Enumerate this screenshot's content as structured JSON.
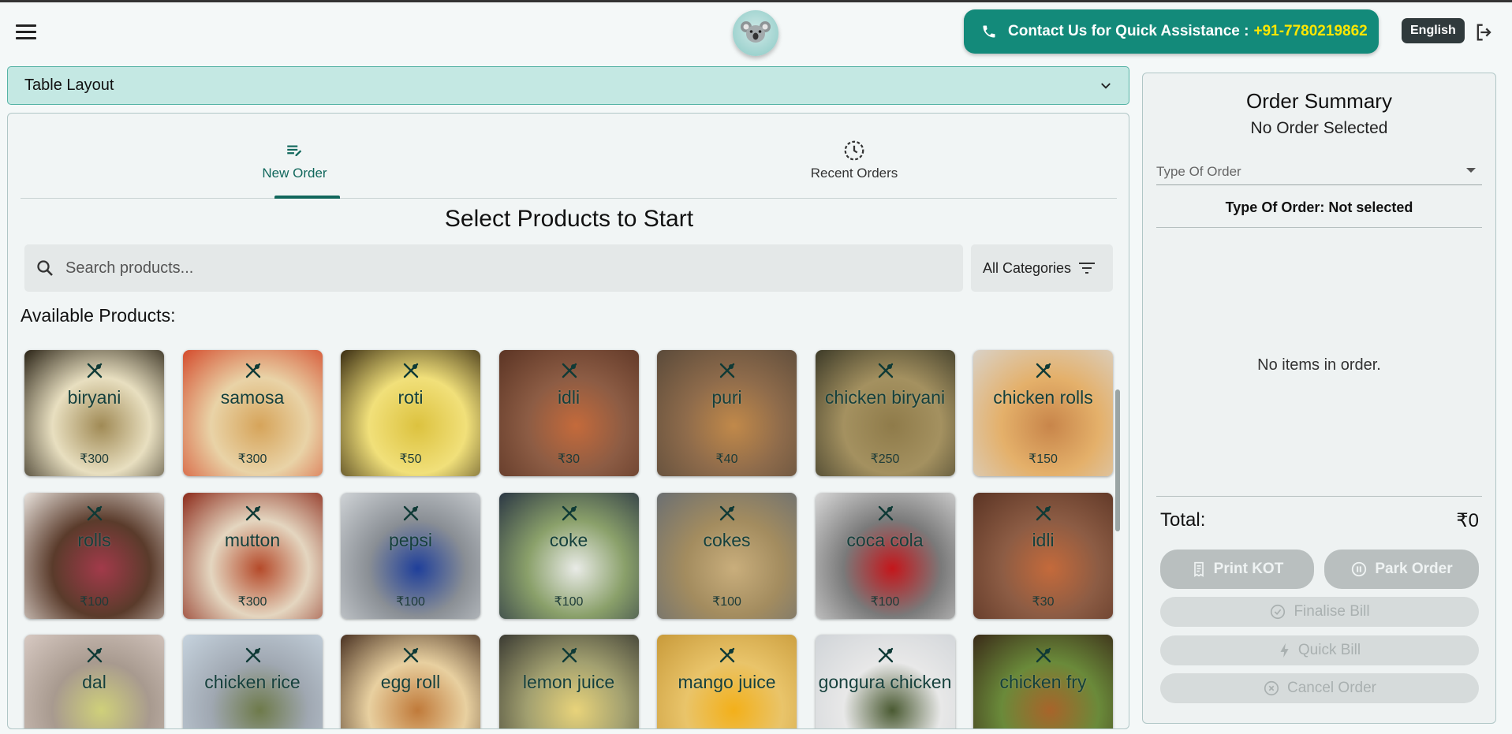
{
  "header": {
    "contact_label": "Contact Us for Quick Assistance :",
    "contact_phone": "+91-7780219862",
    "language": "English"
  },
  "table_layout": {
    "label": "Table Layout"
  },
  "tabs": [
    {
      "label": "New Order",
      "active": true
    },
    {
      "label": "Recent Orders",
      "active": false
    }
  ],
  "main": {
    "title": "Select Products to Start",
    "search_placeholder": "Search products...",
    "category_filter": "All Categories",
    "available_label": "Available Products:"
  },
  "products": [
    {
      "name": "biryani",
      "price": "₹300",
      "colors": [
        "#2a2316",
        "#a08a55",
        "#e8dfc0"
      ]
    },
    {
      "name": "samosa",
      "price": "₹300",
      "colors": [
        "#d44b2c",
        "#d6a45a",
        "#e9d3a7"
      ]
    },
    {
      "name": "roti",
      "price": "₹50",
      "colors": [
        "#3a2d12",
        "#dcc23f",
        "#f1e07a"
      ]
    },
    {
      "name": "idli",
      "price": "₹30",
      "colors": [
        "#5b3424",
        "#c46a3b",
        "#8c5c44"
      ]
    },
    {
      "name": "puri",
      "price": "₹40",
      "colors": [
        "#5a4a3a",
        "#c1894a",
        "#8e6b4b"
      ]
    },
    {
      "name": "chicken biryani",
      "price": "₹250",
      "colors": [
        "#3c3a28",
        "#8f7b4a",
        "#a49160"
      ]
    },
    {
      "name": "chicken rolls",
      "price": "₹150",
      "colors": [
        "#d9d2c8",
        "#c8854a",
        "#e4b06a"
      ]
    },
    {
      "name": "rolls",
      "price": "₹100",
      "colors": [
        "#e8e2dc",
        "#a23a4a",
        "#5a3b2b"
      ]
    },
    {
      "name": "mutton",
      "price": "₹300",
      "colors": [
        "#8c2a1a",
        "#b54a2a",
        "#e4d6c0"
      ]
    },
    {
      "name": "pepsi",
      "price": "₹100",
      "colors": [
        "#cfd3d6",
        "#1f3f9a",
        "#8a8f95"
      ]
    },
    {
      "name": "coke",
      "price": "₹100",
      "colors": [
        "#2b3744",
        "#e9ebe7",
        "#8aa06a"
      ]
    },
    {
      "name": "cokes",
      "price": "₹100",
      "colors": [
        "#6b6f72",
        "#c9ae7c",
        "#a38c5f"
      ]
    },
    {
      "name": "coca cola",
      "price": "₹100",
      "colors": [
        "#d8d8d8",
        "#c4161b",
        "#7a7a7a"
      ]
    },
    {
      "name": "idli",
      "price": "₹30",
      "colors": [
        "#5b3424",
        "#c46a3b",
        "#8c5c44"
      ]
    },
    {
      "name": "dal",
      "price": "",
      "colors": [
        "#d7c9c2",
        "#cfd07a",
        "#a89a8f"
      ]
    },
    {
      "name": "chicken rice",
      "price": "",
      "colors": [
        "#c6d3de",
        "#6e7a4a",
        "#a0a8b2"
      ]
    },
    {
      "name": "egg roll",
      "price": "",
      "colors": [
        "#4a3222",
        "#c07a3a",
        "#e8d0a0"
      ]
    },
    {
      "name": "lemon juice",
      "price": "",
      "colors": [
        "#3a3a32",
        "#e8d37a",
        "#a2a070"
      ]
    },
    {
      "name": "mango juice",
      "price": "",
      "colors": [
        "#c89a3a",
        "#f3b01a",
        "#e9c46a"
      ]
    },
    {
      "name": "gongura chicken",
      "price": "",
      "colors": [
        "#d0d4d8",
        "#4a5a32",
        "#e8e8e8"
      ]
    },
    {
      "name": "chicken fry",
      "price": "",
      "colors": [
        "#3a2a18",
        "#a8642a",
        "#6a8a3a"
      ]
    }
  ],
  "summary": {
    "title": "Order Summary",
    "subtitle": "No Order Selected",
    "type_placeholder": "Type Of Order",
    "type_status": "Type Of Order: Not selected",
    "empty_message": "No items in order.",
    "total_label": "Total:",
    "total_value": "₹0",
    "buttons": {
      "print_kot": "Print KOT",
      "park_order": "Park Order",
      "finalise_bill": "Finalise Bill",
      "quick_bill": "Quick Bill",
      "cancel_order": "Cancel Order"
    }
  }
}
